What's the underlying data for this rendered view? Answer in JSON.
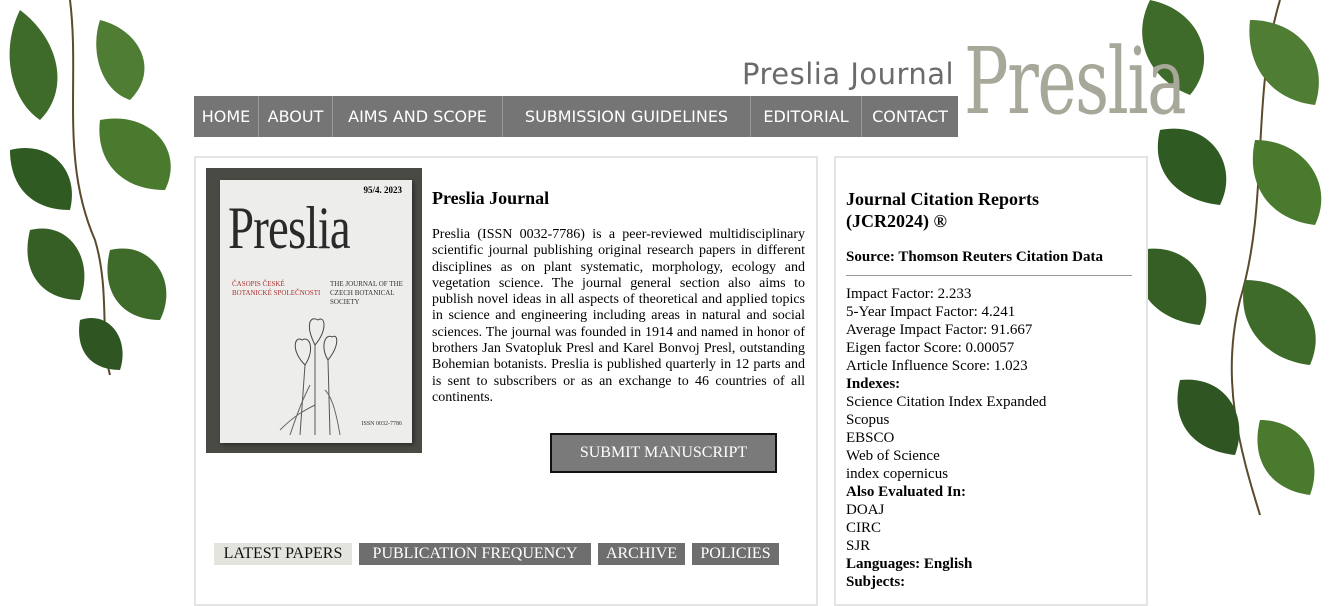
{
  "header": {
    "site_title": "Preslia Journal",
    "logo_text": "Preslia"
  },
  "nav": {
    "items": [
      {
        "label": "HOME"
      },
      {
        "label": "ABOUT"
      },
      {
        "label": "AIMS AND SCOPE"
      },
      {
        "label": "SUBMISSION GUIDELINES"
      },
      {
        "label": "EDITORIAL"
      },
      {
        "label": "CONTACT"
      }
    ]
  },
  "cover": {
    "issue": "95/4. 2023",
    "title": "Preslia",
    "czech_text": "ČASOPIS ČESKÉ BOTANICKÉ SPOLEČNOSTI",
    "english_text": "THE JOURNAL OF THE CZECH BOTANICAL SOCIETY",
    "issn": "ISSN 0032-7786"
  },
  "main": {
    "heading": "Preslia Journal",
    "intro": "Preslia (ISSN 0032-7786) is a peer-reviewed multidisciplinary scientific journal publishing original research papers in different disciplines as on plant systematic, morphology, ecology and vegetation science. The journal general section also aims to publish novel ideas in all aspects of theoretical and applied topics in science and engineering including areas in natural and social sciences. The journal was founded in 1914 and named in honor of brothers Jan Svatopluk Presl and Karel Bonvoj Presl, outstanding Bohemian botanists. Preslia is published quarterly in 12 parts and is sent to subscribers or as an exchange to 46 countries of all continents.",
    "submit_label": "SUBMIT MANUSCRIPT",
    "tabs": [
      {
        "label": "LATEST PAPERS"
      },
      {
        "label": "PUBLICATION FREQUENCY"
      },
      {
        "label": "ARCHIVE"
      },
      {
        "label": "POLICIES"
      }
    ]
  },
  "sidebar": {
    "heading": "Journal Citation Reports (JCR2024) ®",
    "source": "Source: Thomson Reuters Citation Data",
    "metrics": [
      "Impact Factor: 2.233",
      "5-Year Impact Factor: 4.241",
      "Average Impact Factor: 91.667",
      "Eigen factor Score: 0.00057",
      "Article Influence Score: 1.023"
    ],
    "indexes_label": "Indexes:",
    "indexes": [
      "Science Citation Index Expanded",
      "Scopus",
      "EBSCO",
      "Web of Science",
      "index copernicus"
    ],
    "evaluated_label": "Also Evaluated In:",
    "evaluated": [
      "DOAJ",
      "CIRC",
      "SJR"
    ],
    "languages": "Languages: English",
    "subjects_label": "Subjects:"
  }
}
